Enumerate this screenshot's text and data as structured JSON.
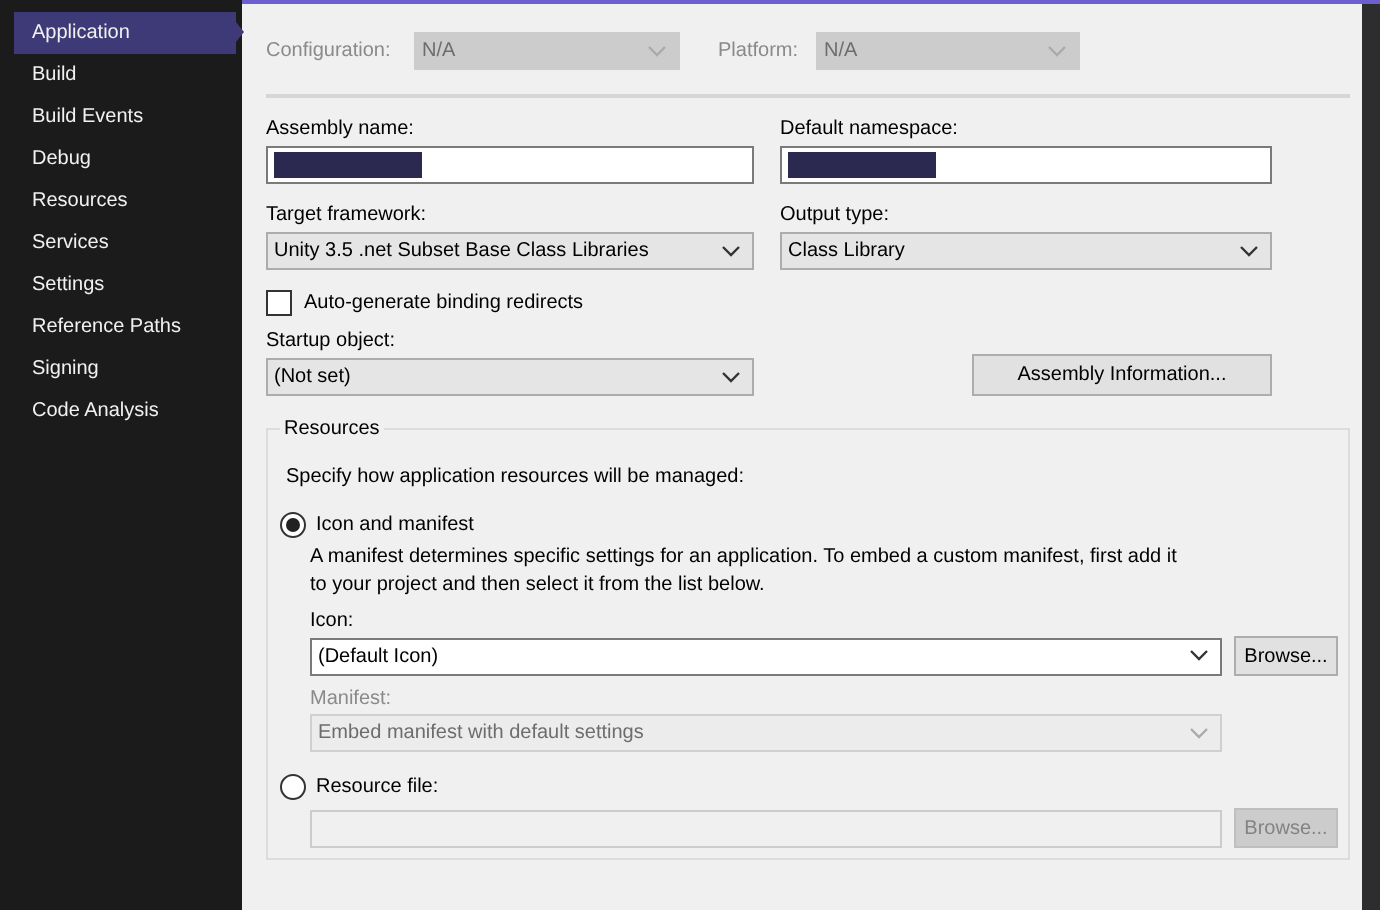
{
  "sidebar": {
    "items": [
      {
        "label": "Application",
        "selected": true
      },
      {
        "label": "Build",
        "selected": false
      },
      {
        "label": "Build Events",
        "selected": false
      },
      {
        "label": "Debug",
        "selected": false
      },
      {
        "label": "Resources",
        "selected": false
      },
      {
        "label": "Services",
        "selected": false
      },
      {
        "label": "Settings",
        "selected": false
      },
      {
        "label": "Reference Paths",
        "selected": false
      },
      {
        "label": "Signing",
        "selected": false
      },
      {
        "label": "Code Analysis",
        "selected": false
      }
    ]
  },
  "toolbar": {
    "configuration": {
      "label": "Configuration:",
      "value": "N/A",
      "disabled": true
    },
    "platform": {
      "label": "Platform:",
      "value": "N/A",
      "disabled": true
    }
  },
  "assembly_name": {
    "label": "Assembly name:",
    "redacted": true
  },
  "default_namespace": {
    "label": "Default namespace:",
    "redacted": true
  },
  "target_framework": {
    "label": "Target framework:",
    "value": "Unity 3.5 .net Subset Base Class Libraries",
    "disabled": false
  },
  "output_type": {
    "label": "Output type:",
    "value": "Class Library",
    "disabled": false
  },
  "binding_redirects": {
    "label": "Auto-generate binding redirects",
    "checked": false
  },
  "startup_object": {
    "label": "Startup object:",
    "value": "(Not set)",
    "disabled": false
  },
  "assembly_information_button": {
    "label": "Assembly Information..."
  },
  "resources": {
    "title": "Resources",
    "description": "Specify how application resources will be managed:",
    "options": [
      {
        "label": "Icon and manifest",
        "selected": true
      },
      {
        "label": "Resource file:",
        "selected": false
      }
    ],
    "manifest_note": "A manifest determines specific settings for an application. To embed a custom manifest, first add it to your project and then select it from the list below.",
    "icon": {
      "label": "Icon:",
      "value": "(Default Icon)",
      "disabled": false,
      "browse": "Browse..."
    },
    "manifest": {
      "label": "Manifest:",
      "value": "Embed manifest with default settings",
      "disabled": true
    },
    "resource_file": {
      "disabled": true,
      "browse": "Browse..."
    }
  }
}
